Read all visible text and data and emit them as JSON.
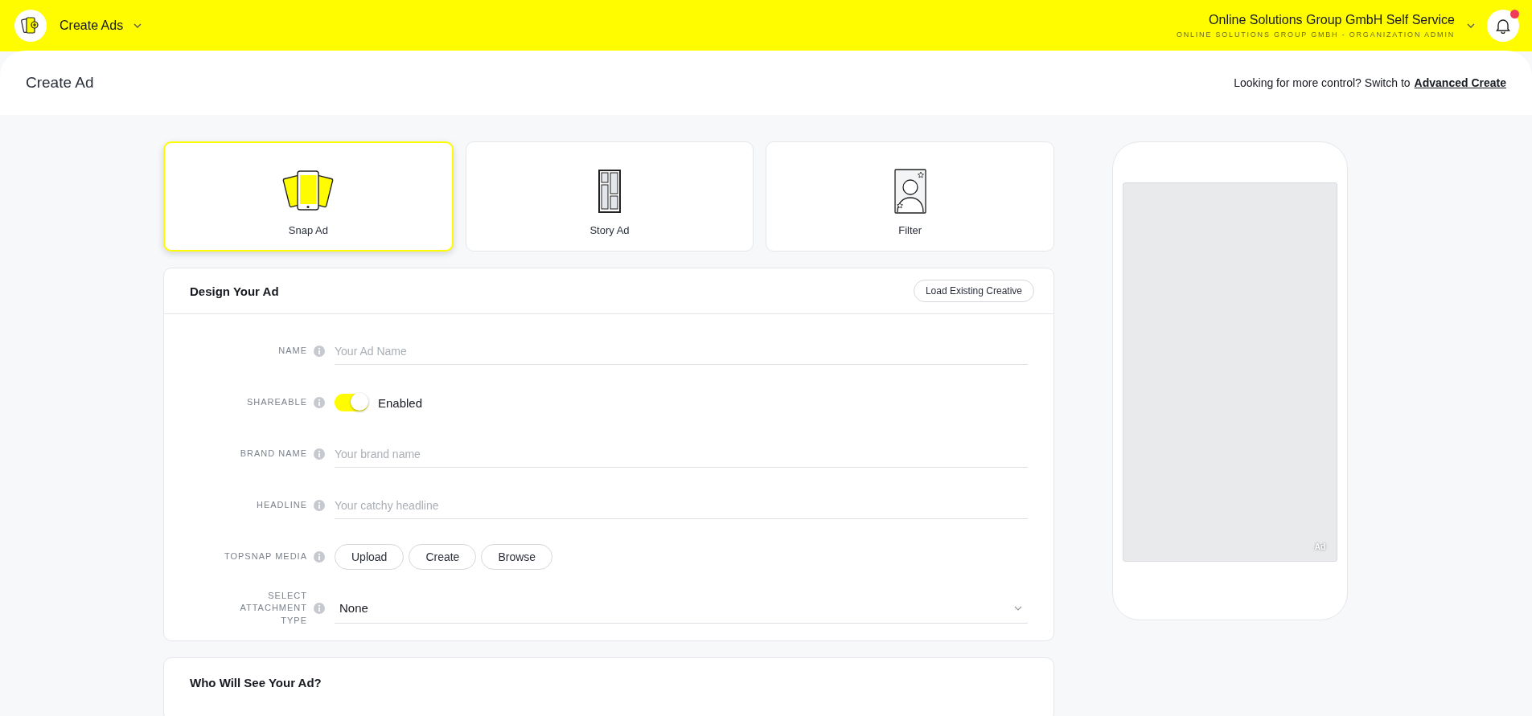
{
  "app_bar": {
    "menu": "Create Ads",
    "org_name": "Online Solutions Group GmbH Self Service",
    "org_role": "ONLINE SOLUTIONS GROUP GMBH - ORGANIZATION ADMIN",
    "unread": true
  },
  "header": {
    "title": "Create Ad",
    "prompt": "Looking for more control? Switch to",
    "link": "Advanced Create"
  },
  "ad_types": [
    {
      "label": "Snap Ad",
      "kind": "snap",
      "selected": true
    },
    {
      "label": "Story Ad",
      "kind": "story",
      "selected": false
    },
    {
      "label": "Filter",
      "kind": "filter",
      "selected": false
    }
  ],
  "design": {
    "title": "Design Your Ad",
    "load_button": "Load Existing Creative",
    "fields": [
      {
        "kind": "text",
        "label": "NAME",
        "placeholder": "Your Ad Name"
      },
      {
        "kind": "toggle",
        "label": "SHAREABLE",
        "on": true,
        "value": "Enabled"
      },
      {
        "kind": "text",
        "label": "BRAND NAME",
        "placeholder": "Your brand name"
      },
      {
        "kind": "text",
        "label": "HEADLINE",
        "placeholder": "Your catchy headline"
      },
      {
        "kind": "buttons",
        "label": "TOPSNAP MEDIA",
        "buttons": [
          "Upload",
          "Create",
          "Browse"
        ]
      },
      {
        "kind": "select",
        "label": "SELECT ATTACHMENT TYPE",
        "value": "None"
      }
    ]
  },
  "preview": {
    "badge": "Ad"
  },
  "audience": {
    "title": "Who Will See Your Ad?"
  }
}
